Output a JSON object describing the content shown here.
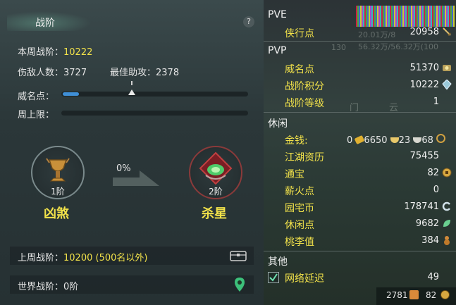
{
  "left": {
    "title": "战阶",
    "help": "?",
    "week_rank_label": "本周战阶：",
    "week_rank_value": "10222",
    "kills_label": "伤敌人数：",
    "kills_value": "3727",
    "assist_label": "最佳助攻：",
    "assist_value": "2378",
    "fame_label": "威名点：",
    "fame_fill": 0.09,
    "fame_marker": 0.36,
    "week_cap_label": "周上限：",
    "current_rank_level": "1阶",
    "current_rank_name": "凶煞",
    "progress": "0%",
    "next_rank_level": "2阶",
    "next_rank_name": "杀星",
    "last_week_label": "上周战阶：",
    "last_week_value": "10200 (500名以外)",
    "world_rank_label": "世界战阶：",
    "world_rank_value": "0阶"
  },
  "right": {
    "pve_header": "PVE",
    "pve": [
      {
        "label": "侠行点",
        "value": "20958",
        "icon": "sword-icon"
      }
    ],
    "pvp_header": "PVP",
    "pvp": [
      {
        "label": "威名点",
        "value": "51370",
        "icon": "fame-icon"
      },
      {
        "label": "战阶积分",
        "value": "10222",
        "icon": "rank-crystal-icon"
      },
      {
        "label": "战阶等级",
        "value": "1",
        "icon": ""
      }
    ],
    "leisure_header": "休闲",
    "money_label": "金钱:",
    "money": {
      "gold": "0",
      "silver": "6650",
      "copper": "23",
      "other": "68"
    },
    "leisure": [
      {
        "label": "江湖资历",
        "value": "75455",
        "icon": ""
      },
      {
        "label": "通宝",
        "value": "82",
        "icon": "coin-icon"
      },
      {
        "label": "薪火点",
        "value": "0",
        "icon": ""
      },
      {
        "label": "园宅币",
        "value": "178741",
        "icon": "house-coin-icon"
      },
      {
        "label": "休闲点",
        "value": "9682",
        "icon": "leaf-icon"
      },
      {
        "label": "桃李值",
        "value": "384",
        "icon": "gourd-icon"
      }
    ],
    "other_header": "其他",
    "net_label": "网络延迟",
    "net_value": "49",
    "footer_left": "2781",
    "footer_right": "82",
    "bg_text": [
      "20.01万/8",
      "56.32万/56.32万(100",
      "130",
      "门",
      "云"
    ]
  },
  "colors": {
    "accent_yellow": "#f2e24a",
    "progress_blue": "#3f8fd6"
  }
}
